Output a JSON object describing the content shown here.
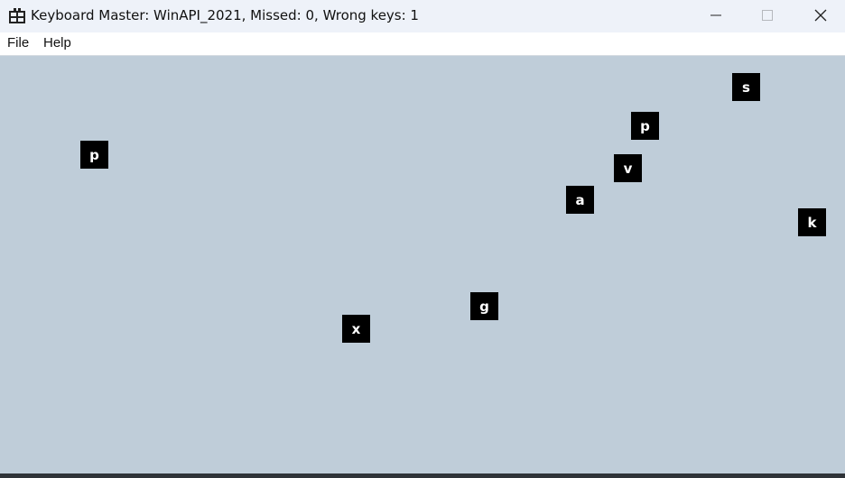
{
  "window": {
    "title": "Keyboard Master: WinAPI_2021, Missed: 0, Wrong keys: 1",
    "icon": "app-grid-icon"
  },
  "menu": {
    "items": [
      {
        "label": "File"
      },
      {
        "label": "Help"
      }
    ]
  },
  "game": {
    "background_color": "#bfcdd9",
    "tile_color": "#000000",
    "tiles": [
      {
        "letter": "s"
      },
      {
        "letter": "p"
      },
      {
        "letter": "p"
      },
      {
        "letter": "v"
      },
      {
        "letter": "a"
      },
      {
        "letter": "k"
      },
      {
        "letter": "g"
      },
      {
        "letter": "x"
      }
    ]
  }
}
